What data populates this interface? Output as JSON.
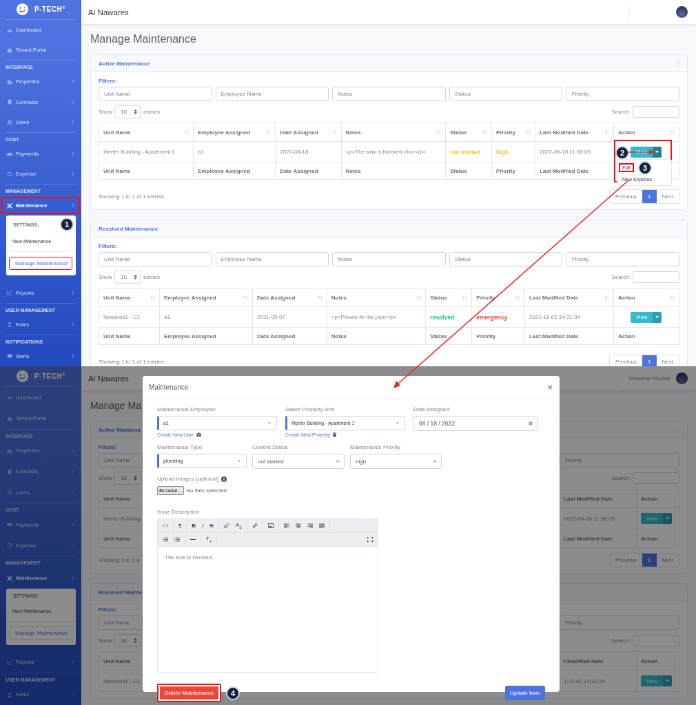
{
  "top_screen": {
    "sidebar": {
      "brand": "P-TECH$^{©}$",
      "items": [
        {
          "kind": "link",
          "label": "Dashboard",
          "has_arrow": false
        },
        {
          "kind": "link",
          "label": "Tenant Portal",
          "has_arrow": false
        },
        {
          "kind": "heading",
          "label": "INTERFACE"
        },
        {
          "kind": "link",
          "label": "Properties",
          "has_arrow": true
        },
        {
          "kind": "link",
          "label": "Contracts",
          "has_arrow": true
        },
        {
          "kind": "link",
          "label": "Users",
          "has_arrow": true
        },
        {
          "kind": "heading",
          "label": "COST"
        },
        {
          "kind": "link",
          "label": "Payments",
          "has_arrow": true
        },
        {
          "kind": "link",
          "label": "Expense",
          "has_arrow": true
        },
        {
          "kind": "heading",
          "label": "MANAGEMENT"
        },
        {
          "kind": "link",
          "label": "Maintenance",
          "has_arrow": true,
          "expanded": true,
          "highlighted": true,
          "submenu": {
            "heading": "SETTINGS:",
            "marker": "1",
            "items": [
              {
                "label": "New Maintenance",
                "selected": false,
                "highlighted": false
              },
              {
                "label": "Manage Maintenance",
                "selected": true,
                "highlighted": true
              }
            ]
          }
        },
        {
          "kind": "link",
          "label": "Reports",
          "has_arrow": true
        },
        {
          "kind": "heading",
          "label": "USER MANAGEMENT"
        },
        {
          "kind": "link",
          "label": "Roles",
          "has_arrow": true
        },
        {
          "kind": "heading",
          "label": "NOTIFICATIONS"
        },
        {
          "kind": "link",
          "label": "Alerts",
          "has_arrow": true
        }
      ]
    },
    "header": {
      "title": "Al Nawares"
    },
    "page_title": "Manage Maintenance",
    "cards": [
      {
        "title": "Active Maintenance",
        "has_menu": true,
        "filters_label": "Filters:",
        "filters": [
          {
            "placeholder": "Unit Name"
          },
          {
            "placeholder": "Employee Name"
          },
          {
            "placeholder": "Notes"
          },
          {
            "placeholder": "Status"
          },
          {
            "placeholder": "Priority"
          }
        ],
        "show_label": "Show",
        "entries_value": "10",
        "entries_label": "entries",
        "search_label": "Search:",
        "columns": [
          "Unit Name",
          "Employee Assigned",
          "Date Assigned",
          "Notes",
          "Status",
          "Priority",
          "Last Modified Date",
          "Action"
        ],
        "rows": [
          {
            "cells": [
              {
                "text": "Merter Building - Apartment 1"
              },
              {
                "text": "a1"
              },
              {
                "text": "2022-08-18"
              },
              {
                "text": "<p>The sink is blocked.<br></p>"
              },
              {
                "text": "not started",
                "color": "#f6c23e"
              },
              {
                "text": "high",
                "color": "#f6c23e"
              },
              {
                "text": "2022-08-18 11:58:05"
              }
            ],
            "action": {
              "label": "View",
              "menu_open": true,
              "highlighted": true,
              "marker": "2",
              "menu": [
                {
                  "label": "Edit",
                  "highlighted": true,
                  "marker": "3"
                },
                {
                  "label": "New Expense",
                  "highlighted": false
                }
              ]
            }
          }
        ],
        "footer": [
          "Unit Name",
          "Employee Assigned",
          "Date Assigned",
          "Notes",
          "Status",
          "Priority",
          "Last Modified Date"
        ],
        "info": "Showing 1 to 1 of 1 entries",
        "pagination": {
          "previous": "Previous",
          "pages": [
            {
              "label": "1",
              "selected": true
            }
          ],
          "next": "Next"
        }
      },
      {
        "title": "Resolved Maintenance",
        "has_menu": false,
        "filters_label": "Filters:",
        "filters": [
          {
            "placeholder": "Unit Name"
          },
          {
            "placeholder": "Employee Name"
          },
          {
            "placeholder": "Notes"
          },
          {
            "placeholder": "Status"
          },
          {
            "placeholder": "Priority"
          }
        ],
        "show_label": "Show",
        "entries_value": "10",
        "entries_label": "entries",
        "search_label": "Search:",
        "columns": [
          "Unit Name",
          "Employee Assigned",
          "Date Assigned",
          "Notes",
          "Status",
          "Priority",
          "Last Modified Date",
          "Action"
        ],
        "rows": [
          {
            "cells": [
              {
                "text": "Nawares1 - C1"
              },
              {
                "text": "a1"
              },
              {
                "text": "2021-05-07"
              },
              {
                "text": "<p>Please fix the pipe</p>"
              },
              {
                "text": "resolved",
                "color": "#1cc88a"
              },
              {
                "text": "emergency",
                "color": "#e74a3b"
              },
              {
                "text": "2021-11-02 14:31:34"
              }
            ],
            "action": {
              "label": "View",
              "menu_open": false
            }
          }
        ],
        "footer": [
          "Unit Name",
          "Employee Assigned",
          "Date Assigned",
          "Notes",
          "Status",
          "Priority",
          "Last Modified Date",
          "Action"
        ],
        "info": "Showing 1 to 1 of 1 entries",
        "pagination": {
          "previous": "Previous",
          "pages": [
            {
              "label": "1",
              "selected": true
            }
          ],
          "next": "Next"
        }
      }
    ]
  },
  "bottom_screen": {
    "sidebar": {
      "brand": "P-TECH$^{©}$",
      "items": [
        {
          "kind": "link",
          "label": "Dashboard",
          "has_arrow": false
        },
        {
          "kind": "link",
          "label": "Tenant Portal",
          "has_arrow": false
        },
        {
          "kind": "heading",
          "label": "INTERFACE"
        },
        {
          "kind": "link",
          "label": "Properties",
          "has_arrow": true
        },
        {
          "kind": "link",
          "label": "Contracts",
          "has_arrow": true
        },
        {
          "kind": "link",
          "label": "Users",
          "has_arrow": true
        },
        {
          "kind": "heading",
          "label": "COST"
        },
        {
          "kind": "link",
          "label": "Payments",
          "has_arrow": true
        },
        {
          "kind": "link",
          "label": "Expense",
          "has_arrow": true
        },
        {
          "kind": "heading",
          "label": "MANAGEMENT"
        },
        {
          "kind": "link",
          "label": "Maintenance",
          "has_arrow": true,
          "expanded": true,
          "highlighted": false,
          "submenu": {
            "heading": "SETTINGS:",
            "items": [
              {
                "label": "New Maintenance",
                "selected": false,
                "highlighted": false
              },
              {
                "label": "Manage Maintenance",
                "selected": true,
                "highlighted": false
              }
            ]
          }
        },
        {
          "kind": "link",
          "label": "Reports",
          "has_arrow": true
        },
        {
          "kind": "heading",
          "label": "USER MANAGEMENT"
        },
        {
          "kind": "link",
          "label": "Roles",
          "has_arrow": true
        }
      ]
    },
    "header": {
      "title": "Al Nawares",
      "user_name": "Muaamar Alkubati"
    },
    "background": {
      "page_title": "Manage Ma",
      "cards": [
        {
          "title": "Active Maintena",
          "has_menu": true,
          "filters_label": "Filters:",
          "filter_left": {
            "placeholder": "Unit Name"
          },
          "filter_right": {
            "placeholder": "Priority"
          },
          "show_label": "Show",
          "entries_value": "10",
          "search_label": "Search:",
          "header_left": "Unit Name",
          "header_right": [
            "Last Modified Date",
            "Action"
          ],
          "row_left": "Merter Building",
          "row_right": "2022-08-18 11:58:05",
          "row_action": "View",
          "footer_left": "Unit Name",
          "footer_right": [
            "Last Modified Date",
            "Action"
          ],
          "info": "Showing 1 to 1 o",
          "pagination": {
            "previous": "Previous",
            "pages": [
              {
                "label": "1",
                "selected": true
              }
            ],
            "next": "Next"
          }
        },
        {
          "title": "Resolved Mainte",
          "has_menu": false,
          "filters_label": "Filters:",
          "filter_left": {
            "placeholder": "Unit Name"
          },
          "filter_right": {
            "placeholder": "Priority"
          },
          "show_label": "Show",
          "entries_value": "10",
          "search_label": "Search:",
          "header_left": "Unit Name",
          "header_right": [
            "t Modified Date",
            "Action"
          ],
          "row_left": "Nawares1 - C1",
          "row_right": "1-11-02 14:31:34",
          "row_action": "View"
        }
      ]
    },
    "modal": {
      "title": "Maintenance",
      "close": "×",
      "row_1": [
        {
          "kind": "select2",
          "label": "Maintenance Employee:",
          "value": "a1",
          "link": "Create New User"
        },
        {
          "kind": "select2",
          "label": "Select Property Unit",
          "value": "Merter Building - Apartment 1",
          "link": "Create New Property"
        },
        {
          "kind": "date",
          "label": "Date Assigned",
          "value": "08 / 18 / 2022"
        }
      ],
      "row_2": [
        {
          "kind": "select2",
          "label": "Maintenance Type",
          "value": "plumbing"
        },
        {
          "kind": "select",
          "label": "Current Status",
          "value": "not started"
        },
        {
          "kind": "select",
          "label": "Maintenance Priority",
          "value": "high"
        }
      ],
      "upload": {
        "label": "Upload Images (optional)",
        "button": "Browse...",
        "status": "No files selected."
      },
      "description": {
        "label": "Issue Description",
        "text": "The sink is blocked.",
        "toolbar": [
          [
            [
              {
                "kind": "code"
              }
            ],
            [
              {
                "kind": "text",
                "label": "¶"
              }
            ],
            [
              {
                "kind": "text",
                "label": "B"
              },
              {
                "kind": "text",
                "label": "I"
              },
              {
                "kind": "text",
                "label": "S"
              }
            ],
            [
              {
                "kind": "text",
                "label": "A$^{x}$"
              },
              {
                "kind": "text",
                "label": "A$_{2}$"
              }
            ],
            [
              {
                "kind": "link"
              }
            ],
            [
              {
                "kind": "image"
              }
            ],
            [
              {
                "kind": "align-left"
              },
              {
                "kind": "align-center"
              },
              {
                "kind": "align-right"
              },
              {
                "kind": "justify"
              }
            ]
          ],
          [
            [
              {
                "kind": "ul"
              },
              {
                "kind": "ol"
              }
            ],
            [
              {
                "kind": "hr"
              }
            ],
            [
              {
                "kind": "text",
                "label": "T$_{x}$"
              }
            ],
            [
              {
                "kind": "fullscreen"
              }
            ]
          ]
        ]
      },
      "delete_button": {
        "label": "Delete Maintenance",
        "highlighted": true,
        "marker": "4"
      },
      "update_button": {
        "label": "Update form"
      }
    }
  }
}
